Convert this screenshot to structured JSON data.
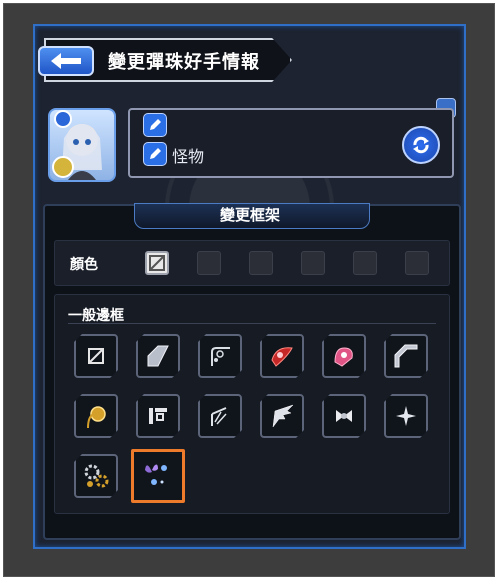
{
  "header": {
    "title": "變更彈珠好手情報",
    "back_icon": "back-arrow-icon"
  },
  "profile": {
    "name": "怪物",
    "edit_icon": "pencil-icon",
    "refresh_icon": "refresh-icon"
  },
  "frame": {
    "title": "變更框架",
    "color_label": "顏色",
    "border_section_label": "一般邊框",
    "colors": [
      "none",
      "#2b2e36",
      "#2b2e36",
      "#2b2e36",
      "#2b2e36",
      "#2b2e36"
    ],
    "border_tiles": [
      {
        "name": "border-none-icon"
      },
      {
        "name": "border-style-silver-icon"
      },
      {
        "name": "border-style-vine-icon"
      },
      {
        "name": "border-style-red-icon"
      },
      {
        "name": "border-style-pink-icon"
      },
      {
        "name": "border-style-steel-icon"
      },
      {
        "name": "border-style-gold-icon"
      },
      {
        "name": "border-style-geometric-icon"
      },
      {
        "name": "border-style-fan-icon"
      },
      {
        "name": "border-style-wing-icon"
      },
      {
        "name": "border-style-ribbon-icon"
      },
      {
        "name": "border-style-star-icon"
      },
      {
        "name": "border-style-gear-icon"
      },
      {
        "name": "border-style-butterfly-icon",
        "selected": true
      }
    ]
  },
  "colors": {
    "accent": "#2f6fc8",
    "selection": "#ee7a2c",
    "panel": "#1d2330"
  }
}
